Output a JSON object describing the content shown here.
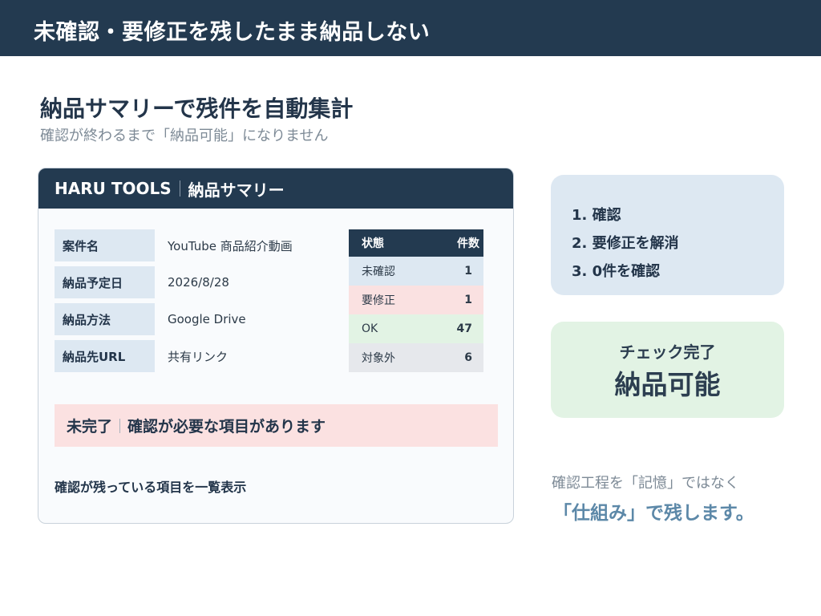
{
  "slide_title": "未確認・要修正を残したまま納品しない",
  "heading": "納品サマリーで残件を自動集計",
  "subheading": "確認が終わるまで「納品可能」になりません",
  "card": {
    "brand": "HARU TOOLS",
    "title": "納品サマリー",
    "fields": [
      {
        "label": "案件名",
        "value": "YouTube 商品紹介動画"
      },
      {
        "label": "納品予定日",
        "value": "2026/8/28"
      },
      {
        "label": "納品方法",
        "value": "Google Drive"
      },
      {
        "label": "納品先URL",
        "value": "共有リンク"
      }
    ],
    "table": {
      "headers": [
        "状態",
        "件数"
      ],
      "rows": [
        {
          "status": "未確認",
          "count": "1"
        },
        {
          "status": "要修正",
          "count": "1"
        },
        {
          "status": "OK",
          "count": "47"
        },
        {
          "status": "対象外",
          "count": "6"
        }
      ]
    },
    "alert_status": "未完了",
    "alert_message": "確認が必要な項目があります",
    "list_caption": "確認が残っている項目を一覧表示"
  },
  "steps": [
    "1. 確認",
    "2. 要修正を解消",
    "3. 0件を確認"
  ],
  "done": {
    "small": "チェック完了",
    "big": "納品可能"
  },
  "note_line1": "確認工程を「記憶」ではなく",
  "note_line2": "「仕組み」で残します。",
  "colors": {
    "navy": "#233a50",
    "light_blue": "#dde8f2",
    "pink": "#fae1e1",
    "green": "#e2f3e4",
    "gray": "#e6e8ec",
    "accent_blue": "#5c88a8"
  }
}
